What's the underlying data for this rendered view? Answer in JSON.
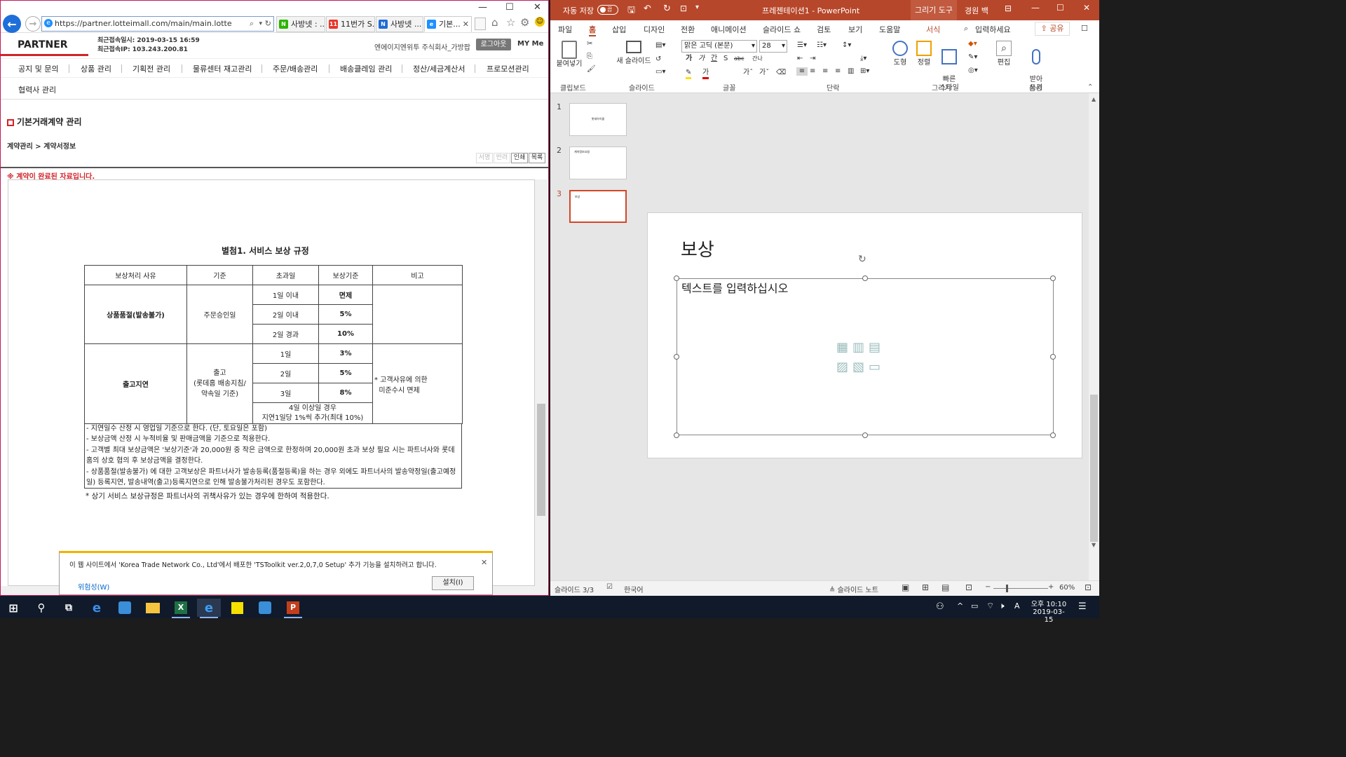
{
  "browser": {
    "url": "https://partner.lotteimall.com/main/main.lotte",
    "tabs": [
      {
        "label": "사방넷 : ...",
        "icon_color": "#2db400",
        "icon_text": "N"
      },
      {
        "label": "11번가 S...",
        "icon_color": "#e8352b",
        "icon_text": "11"
      },
      {
        "label": "사방넷 ...",
        "icon_color": "#1e6bd6",
        "icon_text": "N"
      },
      {
        "label": "기본...",
        "icon_color": "#1e90ff",
        "icon_text": "e"
      }
    ],
    "window_controls": {
      "minimize": "—",
      "maximize": "☐",
      "close": "✕"
    }
  },
  "site": {
    "logo": "PARTNER",
    "last_login_time_label": "최근접속일시: 2019-03-15 16:59",
    "last_login_ip_label": "최근접속IP: 103.243.200.81",
    "company": "엔에이지엔위투 주식회사_가방팝",
    "logout": "로그아웃",
    "my_menu": "MY Me",
    "nav": [
      "공지 및 문의",
      "상품 관리",
      "기획전 관리",
      "물류센터 재고관리",
      "주문/배송관리",
      "배송클레임 관리",
      "정산/세금계산서",
      "프로모션관리",
      "협력사 관리"
    ],
    "section_title": "기본거래계약 관리",
    "breadcrumb": "계약관리 > 계약서정보",
    "action_buttons": [
      "서명",
      "반려",
      "인쇄",
      "목록"
    ],
    "completed_notice": "※ 계약이 완료된 자료입니다."
  },
  "document": {
    "title": "별첨1. 서비스 보상 규정",
    "headers": [
      "보상처리 사유",
      "기준",
      "초과일",
      "보상기준",
      "비고"
    ],
    "group1": {
      "reason": "상품품절(발송불가)",
      "basis": "주문승인일",
      "rows": [
        [
          "1일 이내",
          "면제"
        ],
        [
          "2일 이내",
          "5%"
        ],
        [
          "2일 경과",
          "10%"
        ]
      ]
    },
    "group2": {
      "reason": "출고지연",
      "basis": "출고\n(롯데홈 배송지침/\n약속일 기준)",
      "rows": [
        [
          "1일",
          "3%"
        ],
        [
          "2일",
          "5%"
        ],
        [
          "3일",
          "8%"
        ]
      ],
      "last_row": "4일 이상일 경우\n지연1일당 1%씩 추가(최대 10%)",
      "note": "* 고객사유에 의한\n  미준수시 면제"
    },
    "notes": [
      "- 지연일수 산정 시 영업일 기준으로 한다. (단, 토요일은 포함)",
      "- 보상금액 산정 시 누적비율 및 판매금액을 기준으로 적용한다.",
      "- 고객별 최대 보상금액은 '보상기준'과 20,000원 중 작은 금액으로 한정하며 20,000원 초과 보상 필요 시는 파트너사와 롯데홈의 상호 협의 후 보상금액을 결정한다.",
      "- 상품품절(발송불가) 에 대한 고객보상은 파트너사가 발송등록(품절등록)을 하는 경우 외에도 파트너사의 발송약정일(출고예정일) 등록지연, 발송내역(출고)등록지연으로 인해 발송불가처리된 경우도 포함한다."
    ],
    "footer": "* 상기 서비스 보상규정은 파트너사의 귀책사유가 있는 경우에 한하여 적용한다."
  },
  "notification": {
    "text": "이 웹 사이트에서 'Korea Trade Network Co., Ltd'에서 배포한 'TSToolkit ver.2,0,7,0 Setup' 추가 기능을 설치하려고 합니다.",
    "risk_link": "위험성(W)",
    "install": "설치(I)",
    "close": "✕"
  },
  "ppt": {
    "autosave_label": "자동 저장",
    "autosave_state": "끔",
    "title": "프레젠테이션1 - PowerPoint",
    "drawing_tools": "그리기 도구",
    "user": "경원 백",
    "tabs": [
      "파일",
      "홈",
      "삽입",
      "디자인",
      "전환",
      "애니메이션",
      "슬라이드 쇼",
      "검토",
      "보기",
      "도움말",
      "서식"
    ],
    "active_tab": "홈",
    "tell_me": "입력하세요",
    "share": "공유",
    "ribbon": {
      "paste": "붙여넣기",
      "new_slide": "새 슬라이드",
      "font_name": "맑은 고딕 (본문)",
      "font_size": "28",
      "shapes": "도형",
      "arrange": "정렬",
      "quick_styles": "빠른\n스타일",
      "edit": "편집",
      "dictate": "받아\n쓰기",
      "groups": [
        "클립보드",
        "슬라이드",
        "글꼴",
        "단락",
        "그리기",
        "음성"
      ],
      "font_buttons": [
        "가",
        "가",
        "간",
        "S",
        "abc",
        "간나"
      ]
    },
    "thumbnails": [
      {
        "num": "1",
        "text": "롯데아이몰"
      },
      {
        "num": "2",
        "text": "계약정보요청"
      },
      {
        "num": "3",
        "text": "보상"
      }
    ],
    "slide": {
      "title": "보상",
      "placeholder": "텍스트를 입력하십시오"
    },
    "status": {
      "slide": "슬라이드 3/3",
      "lang": "한국어",
      "notes": "슬라이드 노트",
      "zoom": "60%"
    }
  },
  "taskbar": {
    "time": "오후 10:10",
    "date": "2019-03-15",
    "input_mode": "A"
  }
}
